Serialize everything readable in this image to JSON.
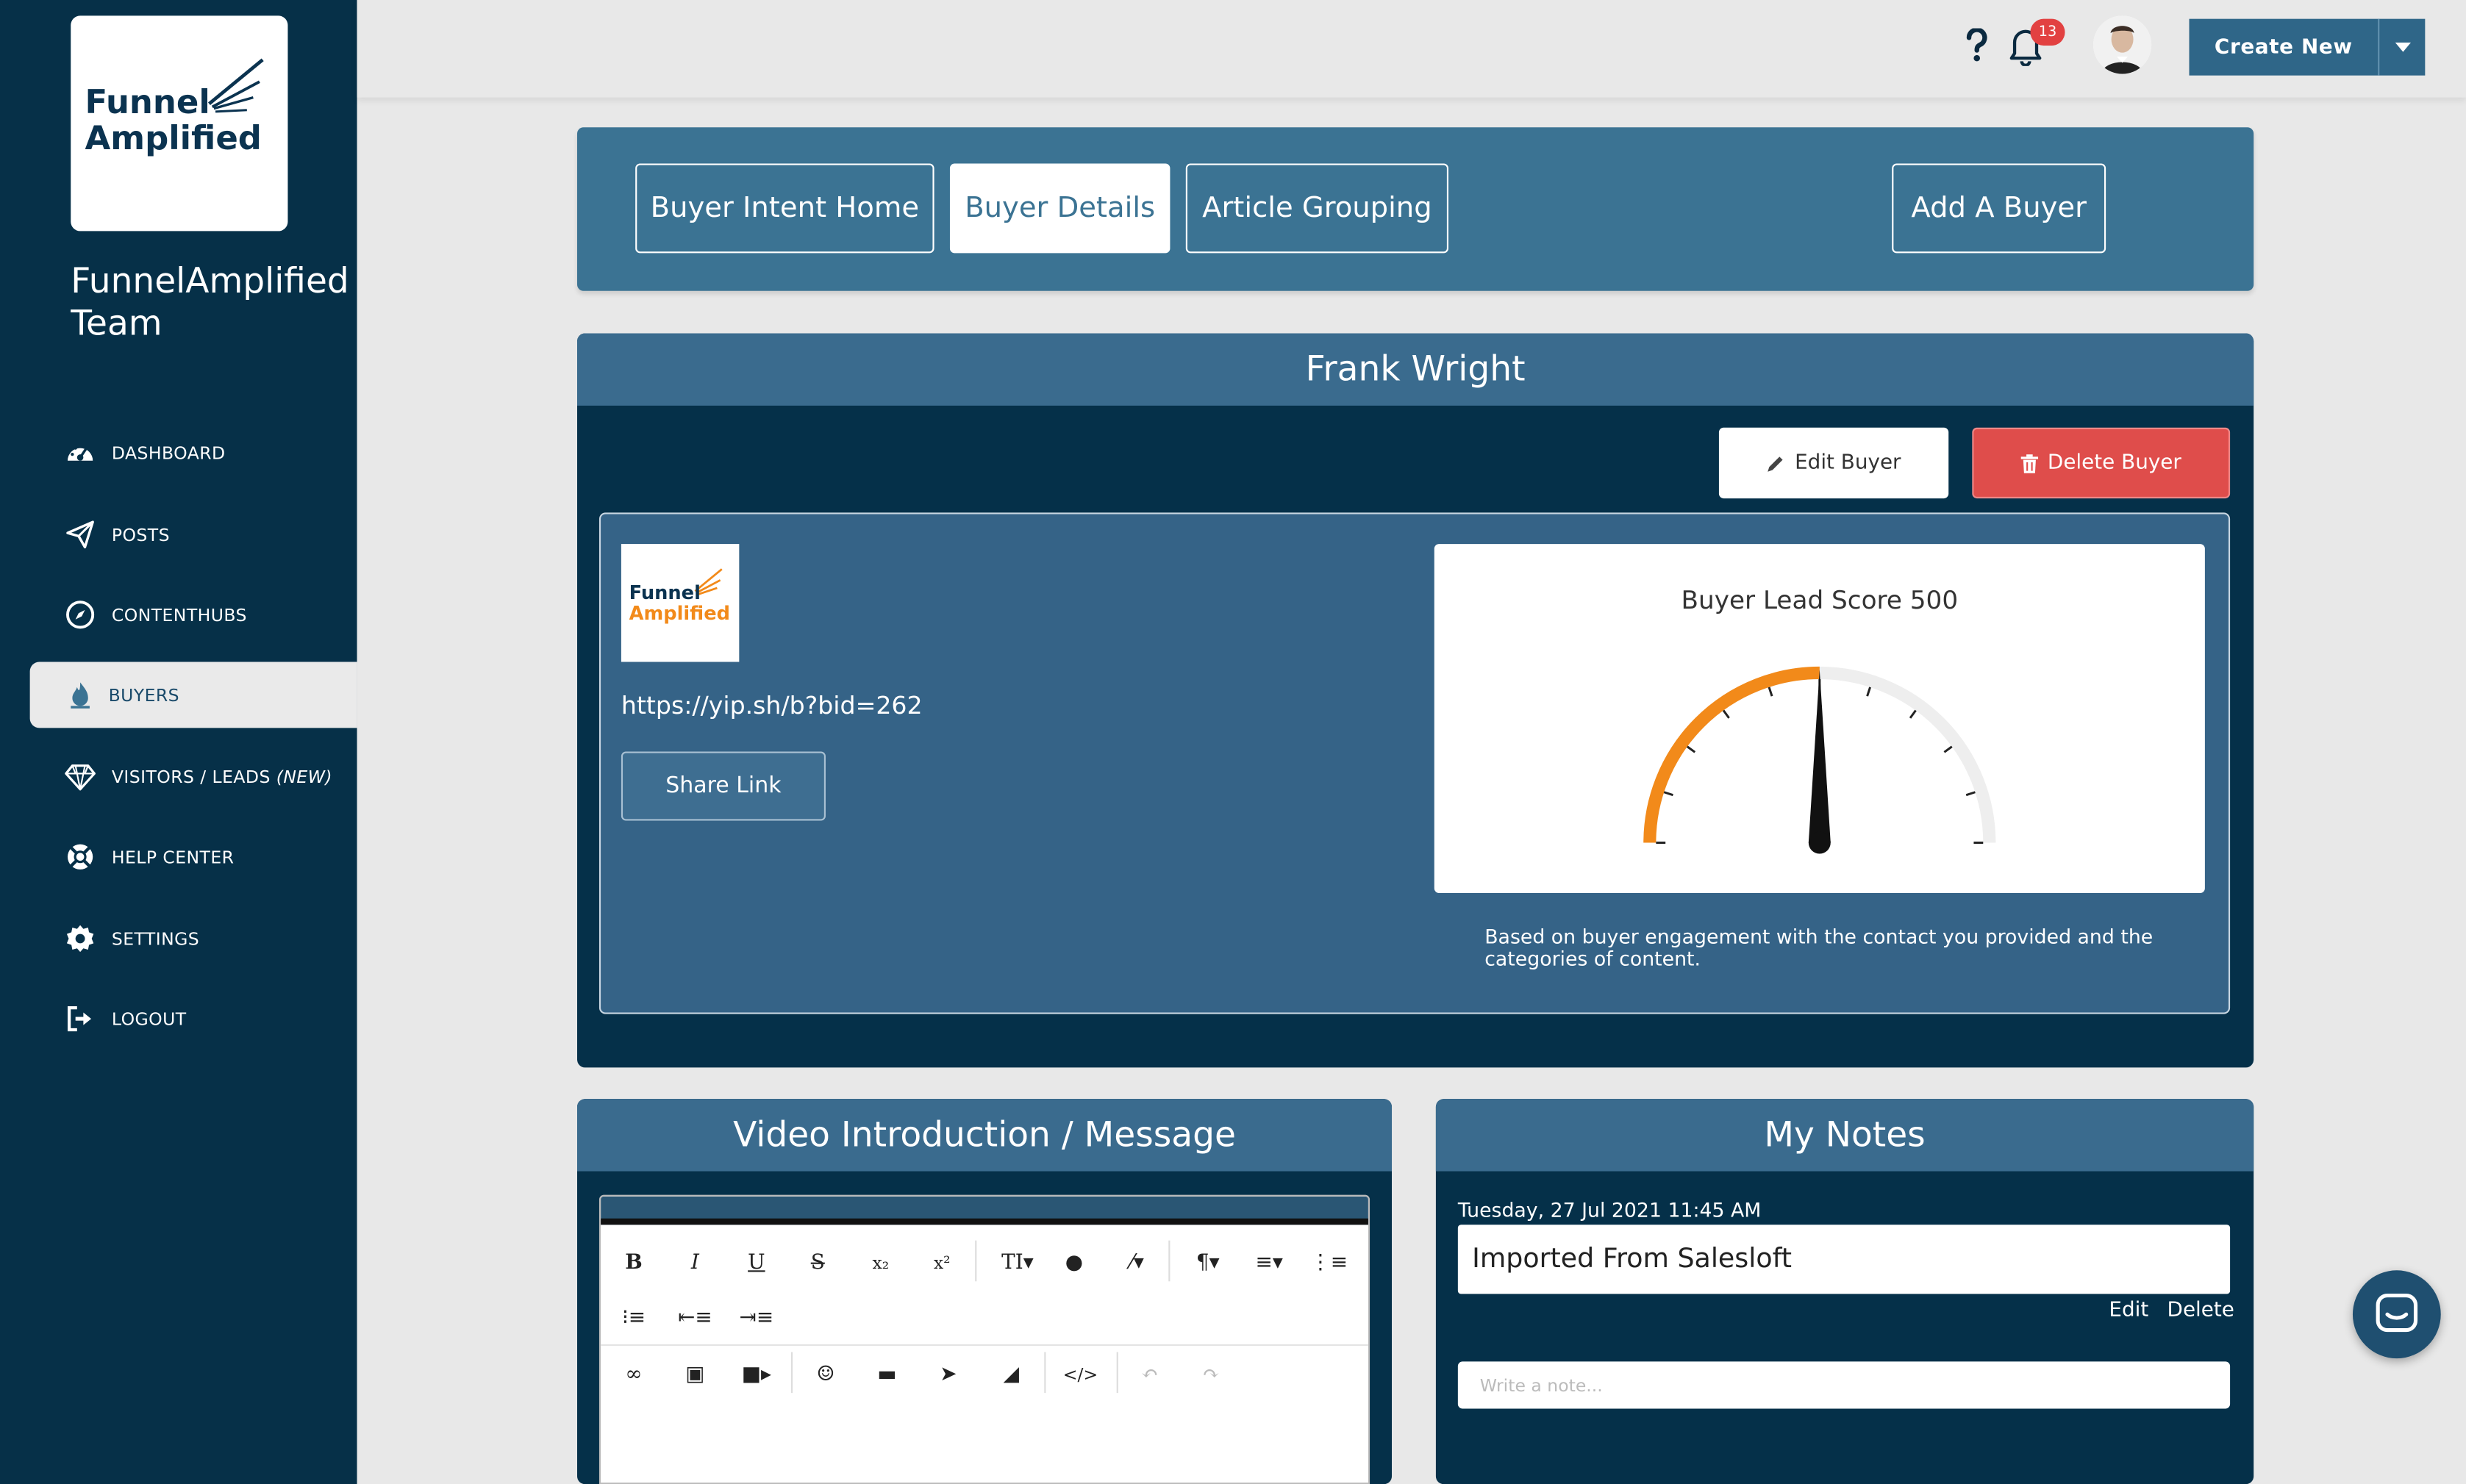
{
  "sidebar": {
    "logo_line1": "Funnel",
    "logo_line2": "Amplified",
    "team_name_line1": "FunnelAmplified",
    "team_name_line2": "Team",
    "items": [
      {
        "label": "DASHBOARD",
        "icon": "dashboard-icon"
      },
      {
        "label": "POSTS",
        "icon": "paper-plane-icon"
      },
      {
        "label": "CONTENTHUBS",
        "icon": "compass-icon"
      },
      {
        "label": "BUYERS",
        "icon": "fire-icon",
        "active": true
      },
      {
        "label": "VISITORS / LEADS",
        "suffix": "(NEW)",
        "icon": "diamond-icon"
      },
      {
        "label": "HELP CENTER",
        "icon": "life-ring-icon"
      },
      {
        "label": "SETTINGS",
        "icon": "gear-icon"
      },
      {
        "label": "LOGOUT",
        "icon": "sign-out-icon"
      }
    ]
  },
  "topbar": {
    "help_icon": "question-icon",
    "notification_count": "13",
    "create_label": "Create New"
  },
  "tabs": [
    {
      "label": "Buyer Intent Home",
      "active": false
    },
    {
      "label": "Buyer Details",
      "active": true
    },
    {
      "label": "Article Grouping",
      "active": false
    },
    {
      "label": "Add A Buyer",
      "active": false
    }
  ],
  "buyer": {
    "name": "Frank Wright",
    "edit_label": "Edit Buyer",
    "delete_label": "Delete Buyer",
    "logo_line1": "Funnel",
    "logo_line2": "Amplified",
    "share_url": "https://yip.sh/b?bid=262",
    "share_label": "Share Link",
    "score_title": "Buyer Lead Score 500",
    "score_fraction": 0.5,
    "score_description": "Based on buyer engagement with the contact you provided and the categories of content."
  },
  "video": {
    "title": "Video Introduction / Message"
  },
  "notes": {
    "title": "My Notes",
    "date": "Tuesday, 27 Jul 2021 11:45 AM",
    "text": "Imported From Salesloft",
    "edit_label": "Edit",
    "delete_label": "Delete",
    "placeholder": "Write a note..."
  },
  "colors": {
    "sidebar": "#063048",
    "accent": "#3b7393",
    "danger": "#df4d4b",
    "gauge_fill": "#f28a1a"
  }
}
